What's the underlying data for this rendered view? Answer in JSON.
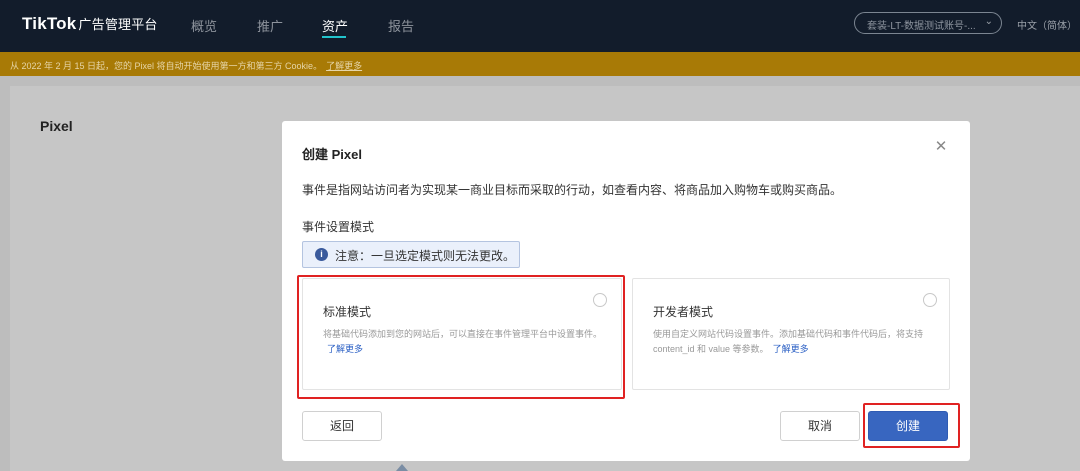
{
  "nav": {
    "logo": "TikTok",
    "logo_sub": "广告管理平台",
    "tabs": [
      {
        "label": "概览"
      },
      {
        "label": "推广"
      },
      {
        "label": "资产"
      },
      {
        "label": "报告"
      }
    ],
    "account": "套装-LT-数据测试账号-...",
    "language": "中文（简体）"
  },
  "banner": {
    "text": "从 2022 年 2 月 15 日起，您的 Pixel 将自动开始使用第一方和第三方 Cookie。",
    "link": "了解更多"
  },
  "page": {
    "title": "Pixel"
  },
  "modal": {
    "title": "创建 Pixel",
    "description": "事件是指网站访问者为实现某一商业目标而采取的行动，如查看内容、将商品加入购物车或购买商品。",
    "mode_label": "事件设置模式",
    "notice": "注意：一旦选定模式则无法更改。",
    "cards": [
      {
        "title": "标准模式",
        "description": "将基础代码添加到您的网站后，可以直接在事件管理平台中设置事件。",
        "link": "了解更多"
      },
      {
        "title": "开发者模式",
        "description": "使用自定义网站代码设置事件。添加基础代码和事件代码后，将支持 content_id 和 value 等参数。",
        "link": "了解更多"
      }
    ],
    "buttons": {
      "back": "返回",
      "cancel": "取消",
      "create": "创建"
    }
  },
  "colors": {
    "nav_bg": "#121c2b",
    "nav_accent": "#22c3cc",
    "banner_bg": "#a87a06",
    "primary": "#3866c0",
    "highlight": "#e02222"
  }
}
